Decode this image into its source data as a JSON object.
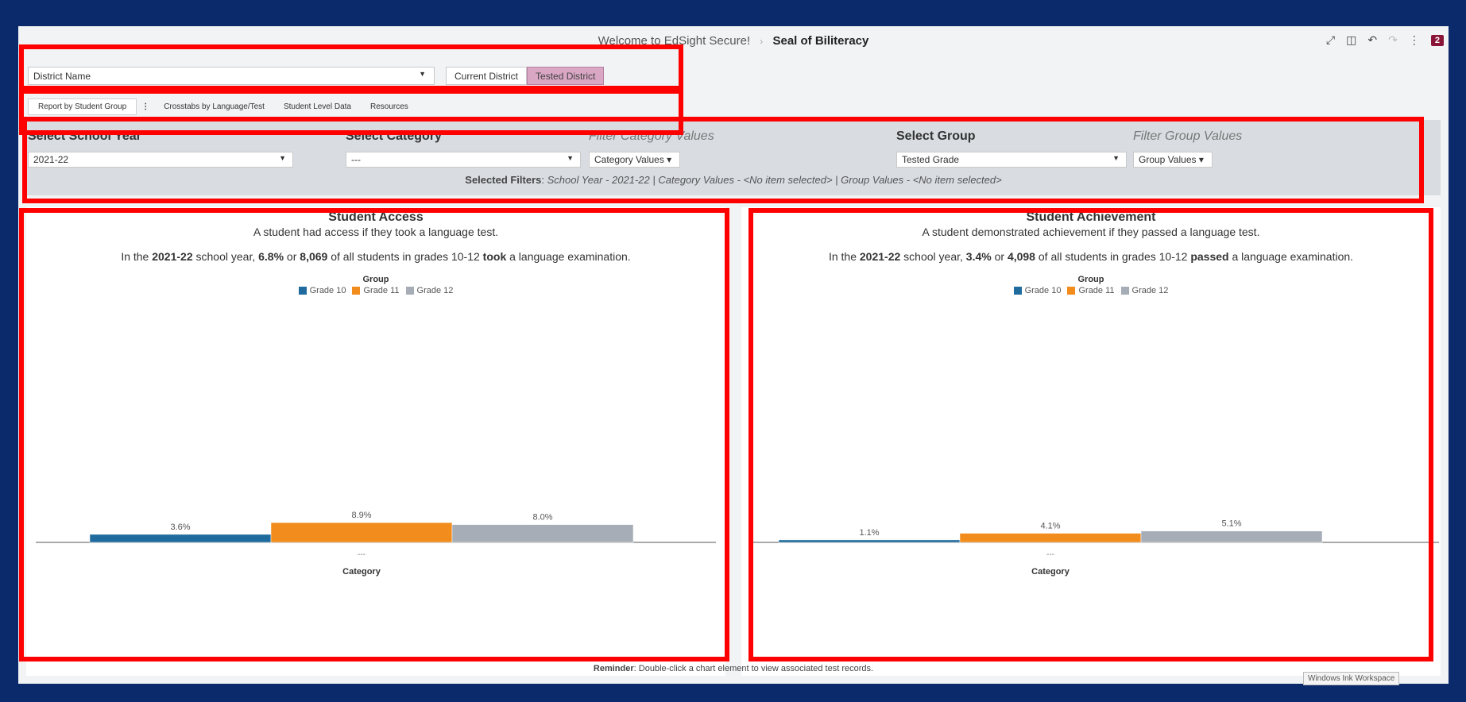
{
  "header": {
    "app_title": "Welcome to EdSight Secure!",
    "separator": "›",
    "page_title": "Seal of Biliteracy",
    "badge_count": "2"
  },
  "toolbar_icons": [
    "expand-icon",
    "panel-icon",
    "undo-icon",
    "redo-icon",
    "more-icon"
  ],
  "district": {
    "value": "District Name",
    "toggle": [
      "Current District",
      "Tested District"
    ],
    "active_toggle": "Tested District"
  },
  "tabs": [
    "Report by Student Group",
    "Crosstabs by Language/Test",
    "Student Level Data",
    "Resources"
  ],
  "tabs_menu_glyph": "⋮",
  "filters": {
    "school_year_label": "Select School Year",
    "school_year_value": "2021-22",
    "category_label": "Select Category",
    "category_value": "---",
    "filter_category_label": "Filter Category Values",
    "category_values_button": "Category Values ▾",
    "group_label": "Select Group",
    "group_value": "Tested Grade",
    "filter_group_label": "Filter Group Values",
    "group_values_button": "Group Values ▾",
    "selected_prefix": "Selected Filters",
    "selected_text": "School Year - 2021-22 | Category Values - <No item selected>  | Group Values - <No item selected>"
  },
  "panels": [
    {
      "title": "Student Access",
      "subtitle": "A student had access if they took a language test.",
      "sentence": {
        "p1": "In the ",
        "year": "2021-22",
        "p2": " school year, ",
        "pct": "6.8%",
        "p3": " or ",
        "count": "8,069",
        "p4": " of all students in grades 10-12 ",
        "verb": "took",
        "p5": " a language examination."
      }
    },
    {
      "title": "Student Achievement",
      "subtitle": "A student demonstrated achievement if they passed a language test.",
      "sentence": {
        "p1": "In the ",
        "year": "2021-22",
        "p2": " school year, ",
        "pct": "3.4%",
        "p3": " or ",
        "count": "4,098",
        "p4": " of all students in grades 10-12 ",
        "verb": "passed",
        "p5": " a language examination."
      }
    }
  ],
  "legend": {
    "title": "Group",
    "items": [
      "Grade 10",
      "Grade 11",
      "Grade 12"
    ]
  },
  "colors": {
    "grade10": "#1f6b9e",
    "grade11": "#f28c1c",
    "grade12": "#a6adb6",
    "highlight": "#ff0000",
    "active_toggle": "#d9a6c4"
  },
  "chart_data": [
    {
      "type": "bar",
      "title": "Student Access",
      "categories": [
        "---"
      ],
      "xlabel": "Category",
      "series": [
        {
          "name": "Grade 10",
          "values": [
            3.6
          ]
        },
        {
          "name": "Grade 11",
          "values": [
            8.9
          ]
        },
        {
          "name": "Grade 12",
          "values": [
            8.0
          ]
        }
      ],
      "labels": [
        "3.6%",
        "8.9%",
        "8.0%"
      ],
      "ylim": [
        0,
        100
      ]
    },
    {
      "type": "bar",
      "title": "Student Achievement",
      "categories": [
        "---"
      ],
      "xlabel": "Category",
      "series": [
        {
          "name": "Grade 10",
          "values": [
            1.1
          ]
        },
        {
          "name": "Grade 11",
          "values": [
            4.1
          ]
        },
        {
          "name": "Grade 12",
          "values": [
            5.1
          ]
        }
      ],
      "labels": [
        "1.1%",
        "4.1%",
        "5.1%"
      ],
      "ylim": [
        0,
        100
      ]
    }
  ],
  "reminder": {
    "prefix": "Reminder",
    "text": ": Double-click a chart element to view associated test records."
  },
  "ink_tooltip": "Windows Ink Workspace"
}
